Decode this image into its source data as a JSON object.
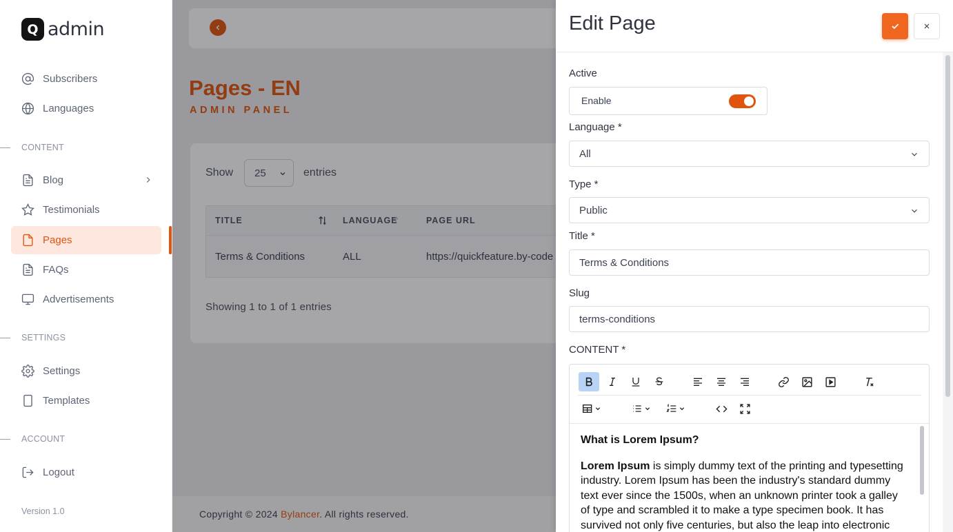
{
  "brand": {
    "mark": "Q",
    "name": "admin"
  },
  "sidebar": {
    "items": [
      {
        "label": "Subscribers",
        "icon": "at-icon"
      },
      {
        "label": "Languages",
        "icon": "globe-icon"
      }
    ],
    "content_label": "CONTENT",
    "content_items": [
      {
        "label": "Blog",
        "icon": "document-icon"
      },
      {
        "label": "Testimonials",
        "icon": "star-icon"
      },
      {
        "label": "Pages",
        "icon": "page-icon",
        "active": true
      },
      {
        "label": "FAQs",
        "icon": "document-icon"
      },
      {
        "label": "Advertisements",
        "icon": "monitor-icon"
      }
    ],
    "settings_label": "SETTINGS",
    "settings_items": [
      {
        "label": "Settings",
        "icon": "gear-icon"
      },
      {
        "label": "Templates",
        "icon": "tablet-icon"
      }
    ],
    "account_label": "ACCOUNT",
    "account_items": [
      {
        "label": "Logout",
        "icon": "logout-icon"
      }
    ],
    "version": "Version 1.0"
  },
  "main": {
    "title": "Pages - EN",
    "subtitle": "ADMIN PANEL",
    "show_label": "Show",
    "entries_value": "25",
    "entries_label": "entries",
    "table": {
      "headers": [
        "TITLE",
        "LANGUAGE",
        "PAGE URL"
      ],
      "rows": [
        [
          "Terms & Conditions",
          "ALL",
          "https://quickfeature.by-code"
        ]
      ]
    },
    "showing": "Showing 1 to 1 of 1 entries",
    "footer": {
      "prefix": "Copyright © 2024 ",
      "brand": "Bylancer",
      "suffix": ". All rights reserved."
    }
  },
  "drawer": {
    "title": "Edit Page",
    "active_label": "Active",
    "enable_label": "Enable",
    "enabled": true,
    "language_label": "Language *",
    "language_value": "All",
    "type_label": "Type *",
    "type_value": "Public",
    "title_label": "Title *",
    "title_value": "Terms & Conditions",
    "slug_label": "Slug",
    "slug_value": "terms-conditions",
    "content_label": "CONTENT *",
    "content": {
      "heading": "What is Lorem Ipsum?",
      "lead_bold": "Lorem Ipsum",
      "paragraph": " is simply dummy text of the printing and typesetting industry. Lorem Ipsum has been the industry's standard dummy text ever since the 1500s, when an unknown printer took a galley of type and scrambled it to make a type specimen book. It has survived not only five centuries, but also the leap into electronic typesetting,"
    }
  },
  "colors": {
    "accent": "#e1540d",
    "accent_light": "#fde7df",
    "text": "#3b4152"
  }
}
